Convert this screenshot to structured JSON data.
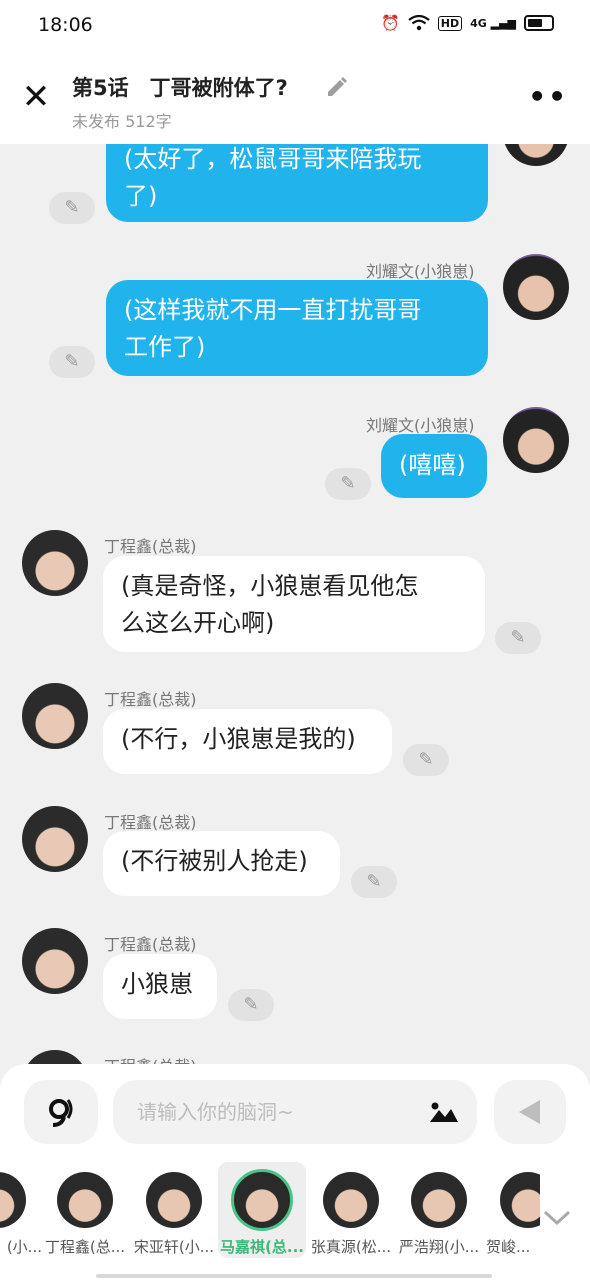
{
  "status": {
    "time": "18:06",
    "hd": "HD",
    "net": "4G"
  },
  "header": {
    "title": "第5话　丁哥被附体了?",
    "subtitle": "未发布 512字"
  },
  "messages": [
    {
      "text": "(太好了，松鼠哥哥来陪我玩了)",
      "line1": "(太好了，松鼠哥哥来陪我玩",
      "line2": "了)"
    },
    {
      "sender": "刘耀文(小狼崽)",
      "line1": "(这样我就不用一直打扰哥哥",
      "line2": "工作了)"
    },
    {
      "sender": "刘耀文(小狼崽)",
      "line1": "(嘻嘻)"
    },
    {
      "sender": "丁程鑫(总裁)",
      "line1": "(真是奇怪，小狼崽看见他怎",
      "line2": "么这么开心啊)"
    },
    {
      "sender": "丁程鑫(总裁)",
      "line1": "(不行，小狼崽是我的)"
    },
    {
      "sender": "丁程鑫(总裁)",
      "line1": "(不行被别人抢走)"
    },
    {
      "sender": "丁程鑫(总裁)",
      "line1": "小狼崽"
    },
    {
      "sender": "丁程鑫(总裁)"
    }
  ],
  "composer": {
    "placeholder": "请输入你的脑洞~"
  },
  "characters": [
    {
      "name": "(小..."
    },
    {
      "name": "丁程鑫(总..."
    },
    {
      "name": "宋亚轩(小..."
    },
    {
      "name": "马嘉祺(总...",
      "selected": true
    },
    {
      "name": "张真源(松..."
    },
    {
      "name": "严浩翔(小..."
    },
    {
      "name": "贺峻..."
    }
  ]
}
